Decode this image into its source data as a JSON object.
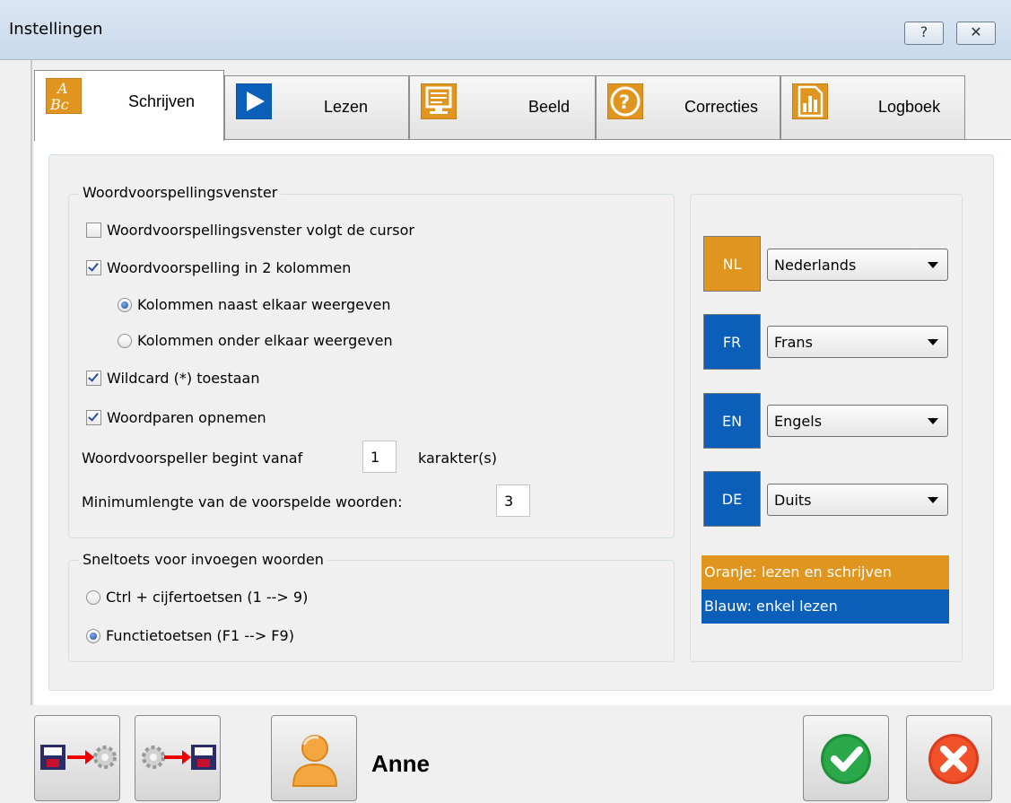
{
  "window": {
    "title": "Instellingen",
    "help_glyph": "?",
    "close_glyph": "✕"
  },
  "tabs": [
    {
      "label": "Schrijven",
      "icon": "abc-icon",
      "active": true
    },
    {
      "label": "Lezen",
      "icon": "play-icon",
      "active": false
    },
    {
      "label": "Beeld",
      "icon": "monitor-icon",
      "active": false
    },
    {
      "label": "Correcties",
      "icon": "question-icon",
      "active": false
    },
    {
      "label": "Logboek",
      "icon": "report-icon",
      "active": false
    }
  ],
  "prediction": {
    "legend": "Woordvoorspellingsvenster",
    "follow_cursor": {
      "label": "Woordvoorspellingsvenster volgt de cursor",
      "checked": false
    },
    "two_columns": {
      "label": "Woordvoorspelling in 2 kolommen",
      "checked": true
    },
    "columns_side": {
      "label": "Kolommen naast elkaar weergeven",
      "checked": true
    },
    "columns_below": {
      "label": "Kolommen onder elkaar weergeven",
      "checked": false
    },
    "wildcard": {
      "label": "Wildcard (*) toestaan",
      "checked": true
    },
    "word_pairs": {
      "label": "Woordparen opnemen",
      "checked": true
    },
    "start_from_label": "Woordvoorspeller begint vanaf",
    "start_from_value": "1",
    "start_from_unit": "karakter(s)",
    "min_length_label": "Minimumlengte van de voorspelde woorden:",
    "min_length_value": "3"
  },
  "shortcut": {
    "legend": "Sneltoets voor invoegen woorden",
    "ctrl_option": {
      "label": "Ctrl + cijfertoetsen (1 --> 9)",
      "checked": false
    },
    "fkey_option": {
      "label": "Functietoetsen (F1 --> F9)",
      "checked": true
    }
  },
  "languages": [
    {
      "code": "NL",
      "value": "Nederlands",
      "color": "#e0951f"
    },
    {
      "code": "FR",
      "value": "Frans",
      "color": "#0b5fb8"
    },
    {
      "code": "EN",
      "value": "Engels",
      "color": "#0b5fb8"
    },
    {
      "code": "DE",
      "value": "Duits",
      "color": "#0b5fb8"
    }
  ],
  "legend_colors": {
    "orange_label": "Oranje: lezen en schrijven",
    "orange": "#e0951f",
    "blue_label": "Blauw: enkel lezen",
    "blue": "#0b5fb8"
  },
  "footer": {
    "user_name": "Anne",
    "buttons": [
      "save-to-settings-icon",
      "settings-to-save-icon",
      "user-icon",
      "ok-check-icon",
      "cancel-x-icon"
    ]
  }
}
